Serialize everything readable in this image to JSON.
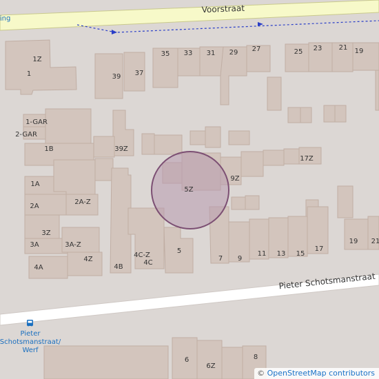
{
  "map": {
    "streets": {
      "top": "Voorstraat",
      "bottom": "Pieter Schotsmanstraat",
      "partial_top_left": "ing"
    },
    "bus_stop": {
      "icon": "bus-icon",
      "label_line1": "Pieter",
      "label_line2": "Schotsmanstraat/",
      "label_line3": "Werf"
    },
    "house_numbers": [
      "1Z",
      "1",
      "39",
      "37",
      "35",
      "33",
      "31",
      "29",
      "27",
      "25",
      "23",
      "21",
      "19",
      "1-GAR",
      "2-GAR",
      "1B",
      "39Z",
      "1A",
      "2A",
      "2A-Z",
      "3Z",
      "3A",
      "3A-Z",
      "4A",
      "4Z",
      "4B",
      "4C-Z",
      "4C",
      "5",
      "5Z",
      "9Z",
      "17Z",
      "7",
      "9",
      "11",
      "13",
      "15",
      "17",
      "19",
      "21",
      "6",
      "6Z",
      "8"
    ],
    "highlight_label": "5Z",
    "colors": {
      "background": "#dcd7d4",
      "building_fill": "#d3c5bd",
      "building_stroke": "#c0aea4",
      "main_road": "#f7f9c9",
      "main_road_edge": "#c9c98c",
      "minor_road": "#ffffff",
      "highlight_fill": "#b89aaf",
      "highlight_stroke": "#7c4f73",
      "path": "#2a3ec7",
      "label": "#333333",
      "poi_label": "#1a6fbf"
    }
  },
  "attribution": {
    "copyright": "©",
    "text": "OpenStreetMap contributors"
  }
}
